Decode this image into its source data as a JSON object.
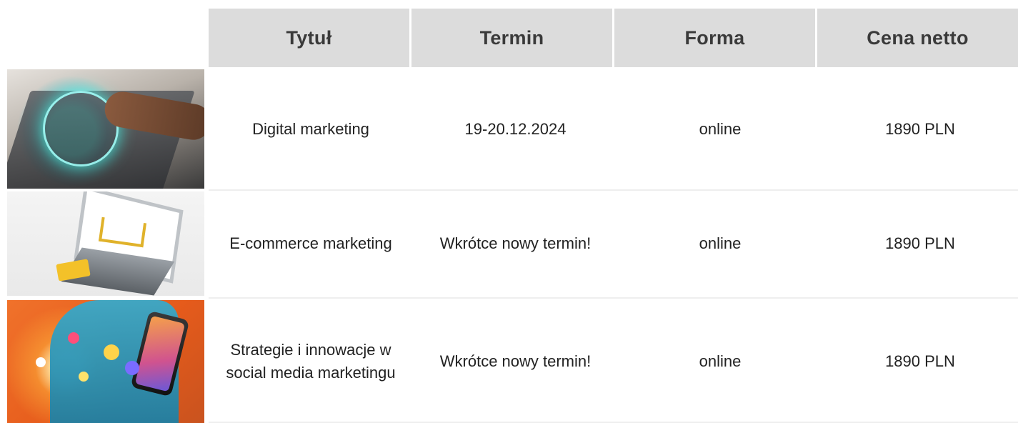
{
  "table": {
    "headers": {
      "title": "Tytuł",
      "date": "Termin",
      "form": "Forma",
      "price": "Cena netto"
    },
    "rows": [
      {
        "title": "Digital marketing",
        "date": "19-20.12.2024",
        "form": "online",
        "price": "1890 PLN"
      },
      {
        "title": "E-commerce marketing",
        "date": "Wkrótce nowy termin!",
        "form": "online",
        "price": "1890 PLN"
      },
      {
        "title": "Strategie i innowacje w social media marketingu",
        "date": "Wkrótce nowy termin!",
        "form": "online",
        "price": "1890 PLN"
      }
    ]
  },
  "colors": {
    "header_bg": "#dcdcdc",
    "header_text": "#3a3a3a",
    "body_text": "#222222",
    "row_separator": "#eeeeee"
  }
}
